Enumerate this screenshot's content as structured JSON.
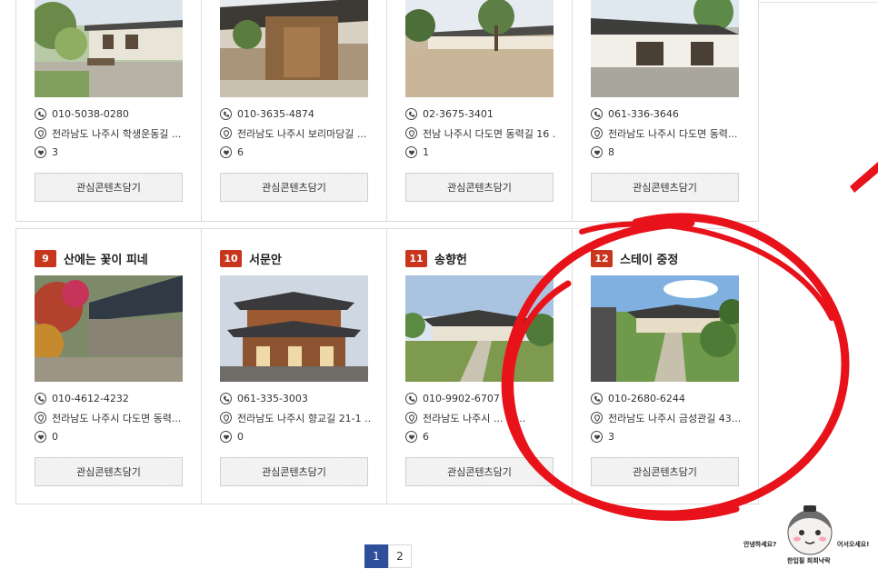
{
  "row1": [
    {
      "phone": "010-5038-0280",
      "address": "전라남도 나주시 학생운동길 ...",
      "likes": "3",
      "button": "관심콘텐츠담기"
    },
    {
      "phone": "010-3635-4874",
      "address": "전라남도 나주시 보리마당길 ...",
      "likes": "6",
      "button": "관심콘텐츠담기"
    },
    {
      "phone": "02-3675-3401",
      "address": "전남 나주시 다도면 동력길 16 ..",
      "likes": "1",
      "button": "관심콘텐츠담기"
    },
    {
      "phone": "061-336-3646",
      "address": "전라남도 나주시 다도면 동력...",
      "likes": "8",
      "button": "관심콘텐츠담기"
    }
  ],
  "row2": [
    {
      "num": "9",
      "name": "산에는 꽃이 피네",
      "phone": "010-4612-4232",
      "address": "전라남도 나주시 다도면 동력...",
      "likes": "0",
      "button": "관심콘텐츠담기"
    },
    {
      "num": "10",
      "name": "서문안",
      "phone": "061-335-3003",
      "address": "전라남도 나주시 향교길 21-1 ..",
      "likes": "0",
      "button": "관심콘텐츠담기"
    },
    {
      "num": "11",
      "name": "송향헌",
      "phone": "010-9902-6707",
      "address": "전라남도 나주시 ... -1 ..",
      "likes": "6",
      "button": "관심콘텐츠담기"
    },
    {
      "num": "12",
      "name": "스테이 중정",
      "phone": "010-2680-6244",
      "address": "전라남도 나주시 금성관길 43...",
      "likes": "3",
      "button": "관심콘텐츠담기"
    }
  ],
  "pagination": {
    "pages": [
      "1",
      "2"
    ],
    "current": "1"
  },
  "mascot": {
    "greeting_left": "안녕하세요?",
    "greeting_right": "어서오세요!",
    "caption": "한입필 희희낙락"
  },
  "colors": {
    "badge": "#c8361d",
    "annotation": "#e8121a",
    "page_active": "#2f4f9a"
  }
}
